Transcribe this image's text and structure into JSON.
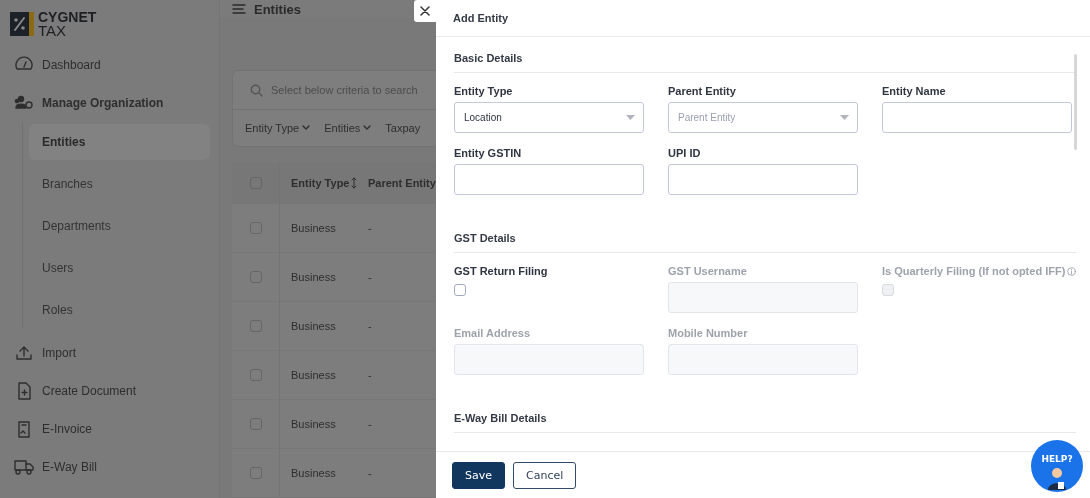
{
  "app": {
    "logo": {
      "line1": "CYGNET",
      "line2": "TAX"
    },
    "page_title": "Entities"
  },
  "sidebar": {
    "items": [
      {
        "label": "Dashboard",
        "selected": false
      },
      {
        "label": "Manage Organization",
        "selected": false,
        "children": [
          {
            "label": "Entities",
            "selected": true
          },
          {
            "label": "Branches",
            "selected": false
          },
          {
            "label": "Departments",
            "selected": false
          },
          {
            "label": "Users",
            "selected": false
          },
          {
            "label": "Roles",
            "selected": false
          }
        ]
      },
      {
        "label": "Import",
        "selected": false
      },
      {
        "label": "Create Document",
        "selected": false
      },
      {
        "label": "E-Invoice",
        "selected": false
      },
      {
        "label": "E-Way Bill",
        "selected": false
      }
    ]
  },
  "search": {
    "placeholder": "Select below criteria to search"
  },
  "filters": [
    {
      "label": "Entity Type"
    },
    {
      "label": "Entities"
    },
    {
      "label": "Taxpay"
    }
  ],
  "table": {
    "all_checked": false,
    "columns": [
      {
        "label": "Entity Type"
      },
      {
        "label": "Parent Entity"
      }
    ],
    "rows": [
      {
        "checked": false,
        "cells": [
          "Business",
          "-"
        ]
      },
      {
        "checked": false,
        "cells": [
          "Business",
          "-"
        ]
      },
      {
        "checked": false,
        "cells": [
          "Business",
          "-"
        ]
      },
      {
        "checked": false,
        "cells": [
          "Business",
          "-"
        ]
      },
      {
        "checked": false,
        "cells": [
          "Business",
          "-"
        ]
      },
      {
        "checked": false,
        "cells": [
          "Business",
          "-"
        ]
      }
    ]
  },
  "drawer": {
    "title": "Add Entity",
    "sections": [
      {
        "title": "Basic Details",
        "fields": [
          {
            "kind": "select",
            "label": "Entity Type",
            "value": "Location",
            "disabled": false
          },
          {
            "kind": "select",
            "label": "Parent Entity",
            "placeholder": "Parent Entity",
            "disabled": false
          },
          {
            "kind": "text",
            "label": "Entity Name",
            "disabled": false
          },
          {
            "kind": "text",
            "label": "Entity GSTIN",
            "disabled": false
          },
          {
            "kind": "text",
            "label": "UPI ID",
            "disabled": false
          }
        ]
      },
      {
        "title": "GST Details",
        "fields": [
          {
            "kind": "checkbox",
            "label": "GST Return Filing",
            "checked": false,
            "disabled": false
          },
          {
            "kind": "text",
            "label": "GST Username",
            "disabled": true
          },
          {
            "kind": "checkbox",
            "label": "Is Quarterly Filing (If not opted IFF)",
            "checked": false,
            "disabled": true,
            "info": true
          },
          {
            "kind": "text",
            "label": "Email Address",
            "disabled": true
          },
          {
            "kind": "text",
            "label": "Mobile Number",
            "disabled": true
          }
        ]
      },
      {
        "title": "E-Way Bill Details"
      }
    ],
    "buttons": [
      {
        "label": "Save",
        "kind": "primary"
      },
      {
        "label": "Cancel",
        "kind": "secondary"
      }
    ]
  },
  "help_badge": {
    "label": "HELP?"
  }
}
